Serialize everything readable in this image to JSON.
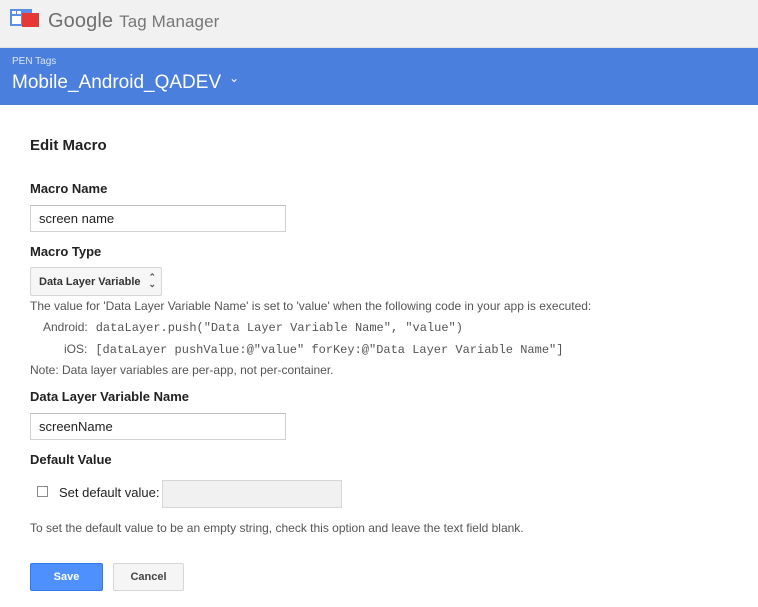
{
  "app": {
    "brand_google": "Google",
    "brand_product": "Tag Manager",
    "logo_icon": "tag-manager-logo-icon"
  },
  "container": {
    "account": "PEN Tags",
    "name": "Mobile_Android_QADEV",
    "chevron_icon": "chevron-down-icon"
  },
  "form": {
    "heading": "Edit Macro",
    "macro_name_label": "Macro Name",
    "macro_name_value": "screen name",
    "macro_type_label": "Macro Type",
    "macro_type_value": "Data Layer Variable",
    "info_line": "The value for 'Data Layer Variable Name' is set to 'value' when the following code in your app is executed:",
    "android_label": "Android:",
    "android_code": "dataLayer.push(\"Data Layer Variable Name\", \"value\")",
    "ios_label": "iOS:",
    "ios_code": "[dataLayer pushValue:@\"value\" forKey:@\"Data Layer Variable Name\"]",
    "note": "Note: Data layer variables are per-app, not per-container.",
    "dlv_name_label": "Data Layer Variable Name",
    "dlv_name_value": "screenName",
    "default_value_label": "Default Value",
    "set_default_label": "Set default value:",
    "set_default_checked": false,
    "default_value": "",
    "help": "To set the default value to be an empty string, check this option and leave the text field blank.",
    "save_label": "Save",
    "cancel_label": "Cancel"
  },
  "colors": {
    "header_blue": "#4a7fdd",
    "save_blue": "#4d90fe"
  }
}
